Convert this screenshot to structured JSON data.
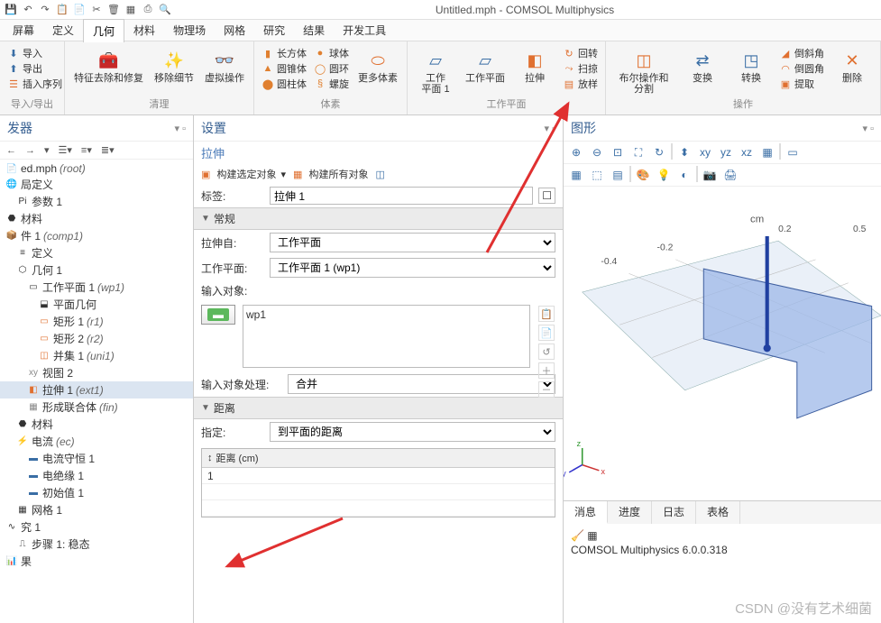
{
  "title": "Untitled.mph - COMSOL Multiphysics",
  "menu": {
    "items": [
      "屏幕",
      "定义",
      "几何",
      "材料",
      "物理场",
      "网格",
      "研究",
      "结果",
      "开发工具"
    ],
    "active": 2
  },
  "ribbon": {
    "io": {
      "import": "导入",
      "export": "导出",
      "insert": "插入序列",
      "label": "导入/导出"
    },
    "clean": {
      "defeature": "特征去除和修复",
      "remove": "移除细节",
      "virtual": "虚拟操作",
      "label": "清理"
    },
    "prim": {
      "box": "长方体",
      "cone": "圆锥体",
      "cyl": "圆柱体",
      "sphere": "球体",
      "torus": "圆环",
      "helix": "螺旋",
      "more": "更多体素",
      "label": "体素"
    },
    "wp": {
      "wp1": "工作\n平面 1",
      "wp": "工作平面",
      "extrude": "拉伸",
      "rot": "回转",
      "sweep": "扫掠",
      "loft": "放样",
      "label": "工作平面"
    },
    "ops": {
      "bool": "布尔操作和分割",
      "trans": "变换",
      "conv": "转换",
      "chamfer": "倒斜角",
      "fillet": "倒圆角",
      "extract": "提取",
      "del": "删除",
      "label": "操作"
    }
  },
  "builder": {
    "title": "发器"
  },
  "tree": [
    {
      "t": "ed.mph (root)",
      "l": 1,
      "i": "📄"
    },
    {
      "t": "局定义",
      "l": 1,
      "i": "🌐"
    },
    {
      "t": "参数 1",
      "l": 2,
      "i": "Pi"
    },
    {
      "t": "材料",
      "l": 1,
      "i": "⬣"
    },
    {
      "t": "件 1 (comp1)",
      "l": 1,
      "i": "📦",
      "em": "(comp1)"
    },
    {
      "t": "定义",
      "l": 2,
      "i": "≡"
    },
    {
      "t": "几何 1",
      "l": 2,
      "i": "⬡"
    },
    {
      "t": "工作平面 1 (wp1)",
      "l": 3,
      "i": "▭",
      "em": "(wp1)"
    },
    {
      "t": "平面几何",
      "l": 4,
      "i": "⬓"
    },
    {
      "t": "矩形 1 (r1)",
      "l": 4,
      "i": "▭",
      "em": "(r1)",
      "c": "ico-orange"
    },
    {
      "t": "矩形 2 (r2)",
      "l": 4,
      "i": "▭",
      "em": "(r2)",
      "c": "ico-orange"
    },
    {
      "t": "并集 1 (uni1)",
      "l": 4,
      "i": "◫",
      "em": "(uni1)",
      "c": "ico-orange"
    },
    {
      "t": "视图 2",
      "l": 3,
      "i": "xy",
      "c": "ico-gray"
    },
    {
      "t": "拉伸 1 (ext1)",
      "l": 3,
      "i": "◧",
      "em": "(ext1)",
      "sel": true,
      "c": "ico-orange"
    },
    {
      "t": "形成联合体 (fin)",
      "l": 3,
      "i": "▦",
      "em": "(fin)",
      "c": "ico-gray"
    },
    {
      "t": "材料",
      "l": 2,
      "i": "⬣"
    },
    {
      "t": "电流 (ec)",
      "l": 2,
      "i": "⚡",
      "em": "(ec)"
    },
    {
      "t": "电流守恒 1",
      "l": 3,
      "i": "▬",
      "c": "ico-blue"
    },
    {
      "t": "电绝缘 1",
      "l": 3,
      "i": "▬",
      "c": "ico-blue"
    },
    {
      "t": "初始值 1",
      "l": 3,
      "i": "▬",
      "c": "ico-blue"
    },
    {
      "t": "网格 1",
      "l": 2,
      "i": "▦"
    },
    {
      "t": "究 1",
      "l": 1,
      "i": "∿"
    },
    {
      "t": "步骤 1: 稳态",
      "l": 2,
      "i": "⎍"
    },
    {
      "t": "果",
      "l": 1,
      "i": "📊"
    }
  ],
  "settings": {
    "title": "设置",
    "sub": "拉伸",
    "build_sel": "构建选定对象",
    "build_all": "构建所有对象",
    "tag_label": "标签:",
    "tag_value": "拉伸 1",
    "sec_general": "常规",
    "from_label": "拉伸自:",
    "from_value": "工作平面",
    "wp_label": "工作平面:",
    "wp_value": "工作平面 1 (wp1)",
    "input_obj": "输入对象:",
    "obj_item": "wp1",
    "handle_label": "输入对象处理:",
    "handle_value": "合并",
    "sec_dist": "距离",
    "spec_label": "指定:",
    "spec_value": "到平面的距离",
    "dist_header": "距离 (cm)",
    "dist_value": "1"
  },
  "graphics": {
    "title": "图形",
    "unit": "cm",
    "ticks": [
      "-0.4",
      "-0.2",
      "0.2",
      "0.5"
    ],
    "axes": {
      "x": "x",
      "y": "y",
      "z": "z"
    }
  },
  "msgs": {
    "tabs": [
      "消息",
      "进度",
      "日志",
      "表格"
    ],
    "text": "COMSOL Multiphysics 6.0.0.318"
  },
  "watermark": "CSDN @没有艺术细菌"
}
